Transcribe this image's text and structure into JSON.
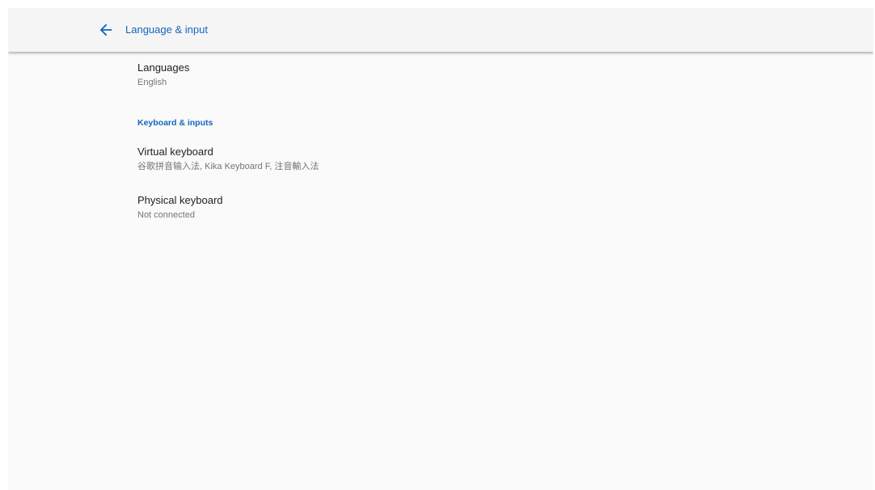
{
  "app_bar": {
    "title": "Language & input",
    "back_icon": "arrow-back-icon",
    "accent_color": "#1565c0"
  },
  "preferences": {
    "languages": {
      "title": "Languages",
      "summary": "English"
    },
    "category_keyboard": {
      "title": "Keyboard & inputs"
    },
    "virtual_keyboard": {
      "title": "Virtual keyboard",
      "summary": "谷歌拼音输入法, Kika Keyboard F, 注音輸入法"
    },
    "physical_keyboard": {
      "title": "Physical keyboard",
      "summary": "Not connected"
    }
  }
}
